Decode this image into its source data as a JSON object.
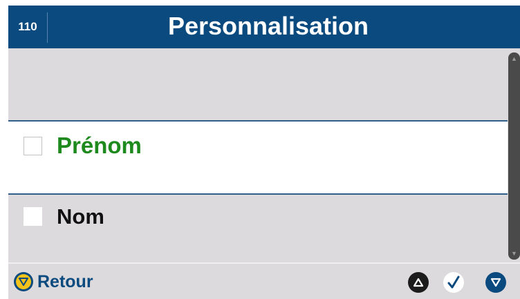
{
  "header": {
    "screen_number": "110",
    "title": "Personnalisation"
  },
  "list": {
    "items": [
      {
        "label": "Prénom",
        "checked": false,
        "selected": true
      },
      {
        "label": "Nom",
        "checked": false,
        "selected": false
      }
    ]
  },
  "footer": {
    "back_label": "Retour",
    "back_icon": "back-circle-icon",
    "up_icon": "triangle-up-icon",
    "ok_icon": "check-icon",
    "down_icon": "triangle-down-icon"
  },
  "colors": {
    "header_bg": "#0a4a7e",
    "selected_text": "#1e8a1e",
    "accent_yellow": "#f3c21b"
  }
}
